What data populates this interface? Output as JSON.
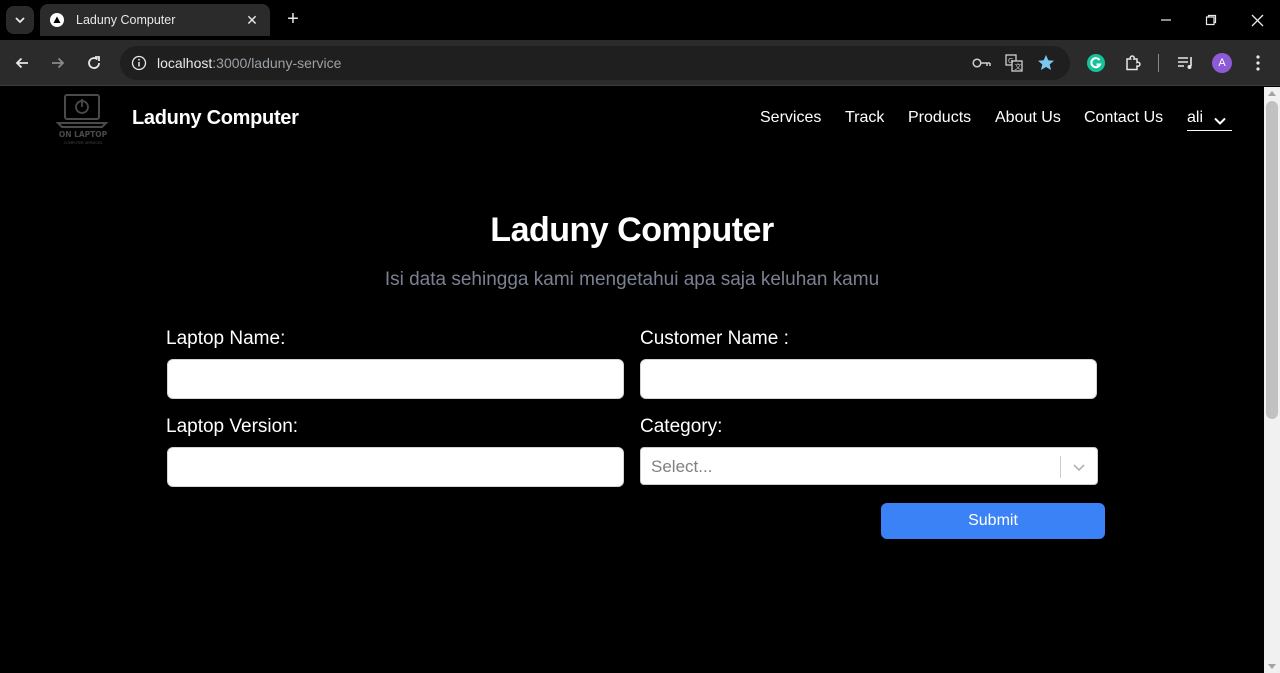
{
  "browser": {
    "tab_title": "Laduny Computer",
    "url_host": "localhost",
    "url_rest": ":3000/laduny-service",
    "profile_initial": "A"
  },
  "header": {
    "logo_text_top": "ON LAPTOP",
    "logo_text_bottom": "COMPUTER SERVICES",
    "brand": "Laduny Computer",
    "nav": [
      "Services",
      "Track",
      "Products",
      "About Us",
      "Contact Us"
    ],
    "user": "ali"
  },
  "hero": {
    "title": "Laduny Computer",
    "subtitle": "Isi data sehingga kami mengetahui apa saja keluhan kamu"
  },
  "form": {
    "laptop_name_label": "Laptop Name:",
    "laptop_name_value": "",
    "customer_name_label": "Customer Name :",
    "customer_name_value": "",
    "laptop_version_label": "Laptop Version:",
    "laptop_version_value": "",
    "category_label": "Category:",
    "category_placeholder": "Select...",
    "submit_label": "Submit"
  },
  "colors": {
    "accent": "#3b82f6",
    "subtitle": "#7a8190",
    "background": "#000000"
  }
}
